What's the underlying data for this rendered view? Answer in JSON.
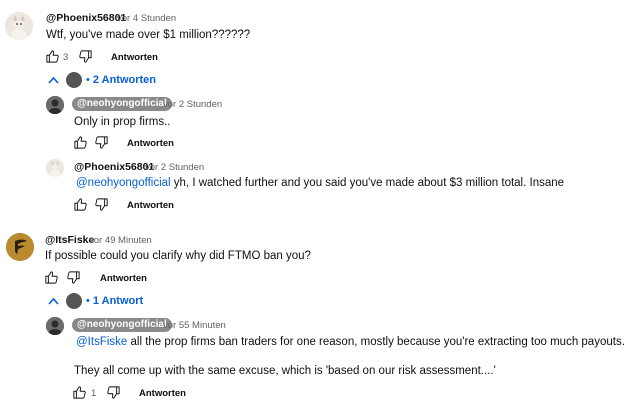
{
  "comments": [
    {
      "handle": "@Phoenix56801",
      "time": "vor 4 Stunden",
      "text": "Wtf, you've made over $1 million??????",
      "likes": "3",
      "reply_label": "Antworten",
      "toggle_label": "2 Antworten",
      "replies": [
        {
          "handle": "@neohyongofficial",
          "time": "vor 2 Stunden",
          "text": "Only in prop firms..",
          "reply_label": "Antworten"
        },
        {
          "handle": "@Phoenix56801",
          "time": "vor 2 Stunden",
          "mention": "@neohyongofficial",
          "text": " yh, I watched further and you said you've made about $3 million total. Insane",
          "reply_label": "Antworten"
        }
      ]
    },
    {
      "handle": "@ItsFiske",
      "time": "vor 49 Minuten",
      "text": "If possible could you clarify why did FTMO ban you?",
      "reply_label": "Antworten",
      "toggle_label": "1 Antwort",
      "replies": [
        {
          "handle": "@neohyongofficial",
          "time": "vor 55 Minuten",
          "mention": "@ItsFiske",
          "text": " all the prop firms ban traders for one reason, mostly because you're extracting too much payouts.",
          "text2": "They all come up with the same excuse, which is 'based on our risk assessment....'",
          "likes": "1",
          "reply_label": "Antworten"
        }
      ]
    }
  ],
  "icons": {
    "like": "thumb-up-icon",
    "dislike": "thumb-down-icon",
    "collapse": "chevron-up-icon"
  },
  "colors": {
    "link": "#065fd4",
    "pill": "#8a8a8a",
    "secondary_text": "#606060"
  }
}
